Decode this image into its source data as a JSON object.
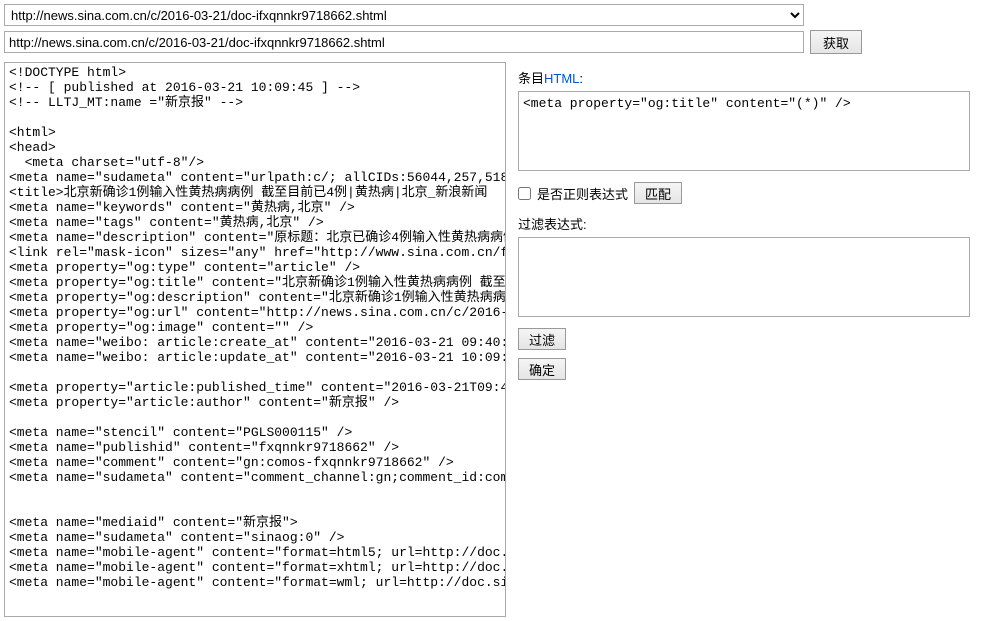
{
  "topbar": {
    "select_value": "http://news.sina.com.cn/c/2016-03-21/doc-ifxqnnkr9718662.shtml",
    "input_value": "http://news.sina.com.cn/c/2016-03-21/doc-ifxqnnkr9718662.shtml",
    "fetch_btn": "获取"
  },
  "source_html": "<!DOCTYPE html>\n<!-- [ published at 2016-03-21 10:09:45 ] -->\n<!-- LLTJ_MT:name =\"新京报\" -->\n\n<html>\n<head>\n  <meta charset=\"utf-8\"/>\n<meta name=\"sudameta\" content=\"urlpath:c/; allCIDs:56044,257,51895,51923\n<title>北京新确诊1例输入性黄热病病例 截至目前已4例|黄热病|北京_新浪新闻\n<meta name=\"keywords\" content=\"黄热病,北京\" />\n<meta name=\"tags\" content=\"黄热病,北京\" />\n<meta name=\"description\" content=\"原标题：北京已确诊4例输入性黄热病病例\n<link rel=\"mask-icon\" sizes=\"any\" href=\"http://www.sina.com.cn/favicon.\n<meta property=\"og:type\" content=\"article\" />\n<meta property=\"og:title\" content=\"北京新确诊1例输入性黄热病病例 截至目\n<meta property=\"og:description\" content=\"北京新确诊1例输入性黄热病病例\n<meta property=\"og:url\" content=\"http://news.sina.com.cn/c/2016-03-21/d\n<meta property=\"og:image\" content=\"\" />\n<meta name=\"weibo: article:create_at\" content=\"2016-03-21 09:40:51\" />\n<meta name=\"weibo: article:update_at\" content=\"2016-03-21 10:09:44\" />\n\n<meta property=\"article:published_time\" content=\"2016-03-21T09:40:52+08\n<meta property=\"article:author\" content=\"新京报\" />\n\n<meta name=\"stencil\" content=\"PGLS000115\" />\n<meta name=\"publishid\" content=\"fxqnnkr9718662\" />\n<meta name=\"comment\" content=\"gn:comos-fxqnnkr9718662\" />\n<meta name=\"sudameta\" content=\"comment_channel:gn;comment_id:comos-fxqn\n\n\n<meta name=\"mediaid\" content=\"新京报\">\n<meta name=\"sudameta\" content=\"sinaog:0\" />\n<meta name=\"mobile-agent\" content=\"format=html5; url=http://doc.sina.cn\n<meta name=\"mobile-agent\" content=\"format=xhtml; url=http://doc.sina.cn\n<meta name=\"mobile-agent\" content=\"format=wml; url=http://doc.sina.cn/?",
  "right": {
    "entry_label_prefix": "条目",
    "entry_label_html": "HTML",
    "entry_label_suffix": ":",
    "entry_value": "<meta property=\"og:title\" content=\"(*)\" />",
    "regex_checkbox_label": "是否正则表达式",
    "match_btn": "匹配",
    "filter_label": "过滤表达式:",
    "filter_value": "",
    "filter_btn": "过滤",
    "confirm_btn": "确定"
  }
}
